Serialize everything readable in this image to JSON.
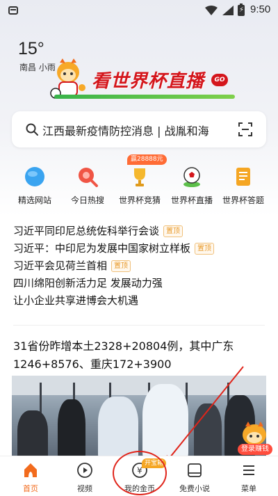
{
  "status_bar": {
    "time": "9:50"
  },
  "weather": {
    "temperature": "15°",
    "location": "南昌 小雨"
  },
  "banner": {
    "title": "看世界杯直播",
    "go": "GO"
  },
  "search": {
    "query": "江西最新疫情防控消息 | 战胤和海"
  },
  "quick_links": [
    {
      "label": "精选网站",
      "icon": "globe-icon"
    },
    {
      "label": "今日热搜",
      "icon": "hot-search-icon"
    },
    {
      "label": "世界杯竞猜",
      "icon": "trophy-icon"
    },
    {
      "label": "世界杯直播",
      "icon": "football-icon"
    },
    {
      "label": "世界杯答题",
      "icon": "quiz-icon"
    }
  ],
  "prize_badge": "赢28888元",
  "news": [
    {
      "title": "习近平同印尼总统佐科举行会谈",
      "tag": "置顶"
    },
    {
      "title": "习近平：中印尼为发展中国家树立样板",
      "tag": "置顶"
    },
    {
      "title": "习近平会见荷兰首相",
      "tag": "置顶"
    },
    {
      "title": "四川绵阳创新活力足 发展动力强",
      "tag": ""
    },
    {
      "title": "让小企业共享进博会大机遇",
      "tag": ""
    }
  ],
  "headline": "31省份昨增本土2328+20804例，其中广东1246+8576、重庆172+3900",
  "coin_earn": "登录赚钱",
  "bottom_nav": [
    {
      "label": "首页",
      "icon": "home-icon",
      "active": true
    },
    {
      "label": "视频",
      "icon": "video-icon",
      "active": false
    },
    {
      "label": "我的金币",
      "icon": "coin-icon",
      "active": false
    },
    {
      "label": "免费小说",
      "icon": "book-icon",
      "active": false
    },
    {
      "label": "菜单",
      "icon": "menu-icon",
      "active": false
    }
  ],
  "gold_badge": "开宝箱",
  "colors": {
    "accent": "#f26b1d",
    "banner_red": "#d4161c",
    "pin_tag": "#e89a2b",
    "annotation_red": "#e0241a"
  }
}
